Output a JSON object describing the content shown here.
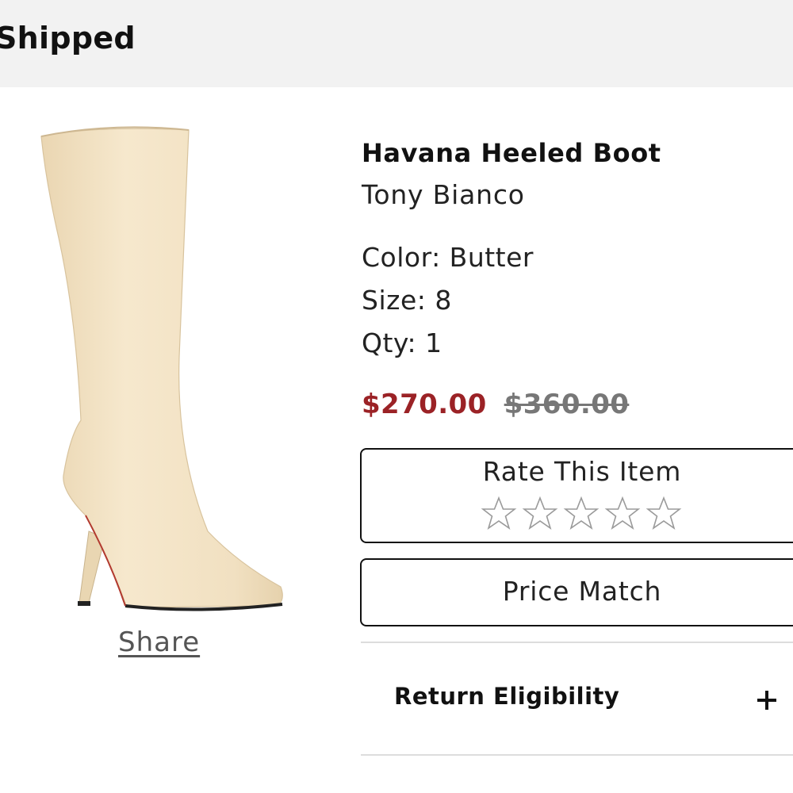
{
  "order_status": {
    "label": "Shipped"
  },
  "product": {
    "name": "Havana Heeled Boot",
    "brand": "Tony Bianco",
    "color": "Color: Butter",
    "size": "Size: 8",
    "qty": "Qty: 1",
    "sale_price": "$270.00",
    "original_price": "$360.00",
    "image_icon": "boot-image",
    "colors": {
      "sale": "#9b2226",
      "boot": "#f3e3c5",
      "stars": "#9a9a9a"
    }
  },
  "share": {
    "label": "Share"
  },
  "rating": {
    "title": "Rate This Item",
    "max_stars": 5,
    "current": 0
  },
  "price_match": {
    "label": "Price Match"
  },
  "return_eligibility": {
    "label": "Return Eligibility",
    "icon": "plus-icon"
  }
}
